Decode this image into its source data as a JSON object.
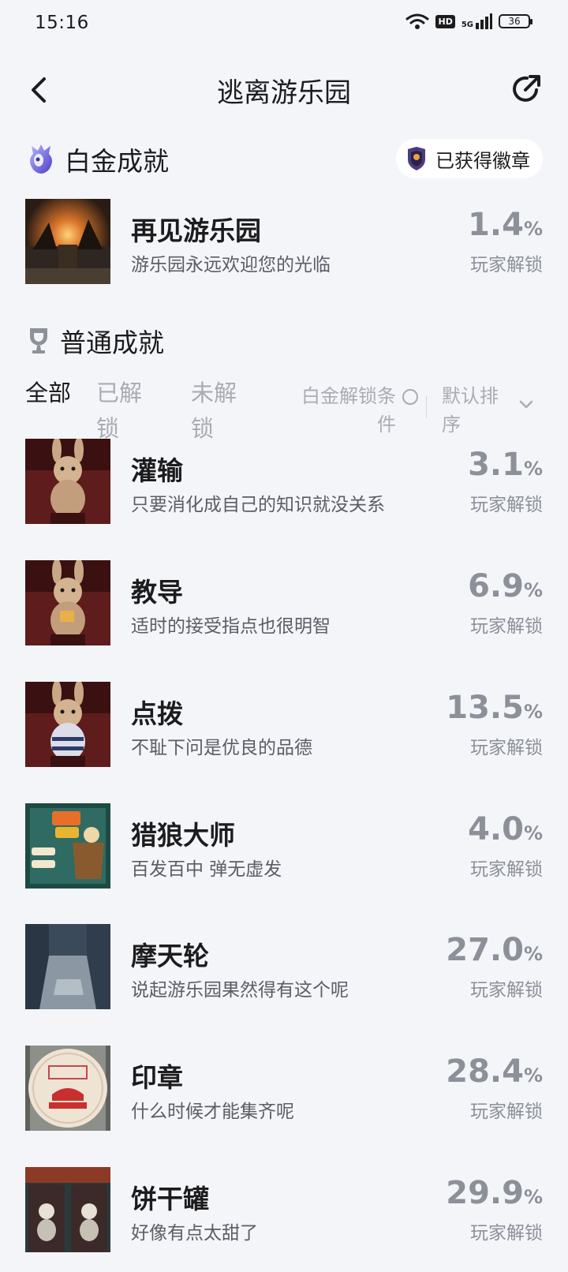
{
  "status_bar": {
    "time": "15:16",
    "hd": "HD",
    "network": "5G",
    "battery": "36"
  },
  "header": {
    "title": "逃离游乐园"
  },
  "platinum": {
    "section_title": "白金成就",
    "badge_label": "已获得徽章",
    "item": {
      "name": "再见游乐园",
      "desc": "游乐园永远欢迎您的光临",
      "percent": "1.4",
      "percent_sign": "%",
      "unlock_label": "玩家解锁"
    }
  },
  "normal": {
    "section_title": "普通成就",
    "filters": {
      "tabs": [
        "全部",
        "已解锁",
        "未解锁"
      ],
      "condition": "白金解锁条件",
      "sort": "默认排序"
    },
    "items": [
      {
        "name": "灌输",
        "desc": "只要消化成自己的知识就没关系",
        "percent": "3.1",
        "percent_sign": "%",
        "unlock_label": "玩家解锁"
      },
      {
        "name": "教导",
        "desc": "适时的接受指点也很明智",
        "percent": "6.9",
        "percent_sign": "%",
        "unlock_label": "玩家解锁"
      },
      {
        "name": "点拨",
        "desc": "不耻下问是优良的品德",
        "percent": "13.5",
        "percent_sign": "%",
        "unlock_label": "玩家解锁"
      },
      {
        "name": "猎狼大师",
        "desc": "百发百中 弹无虚发",
        "percent": "4.0",
        "percent_sign": "%",
        "unlock_label": "玩家解锁"
      },
      {
        "name": "摩天轮",
        "desc": "说起游乐园果然得有这个呢",
        "percent": "27.0",
        "percent_sign": "%",
        "unlock_label": "玩家解锁"
      },
      {
        "name": "印章",
        "desc": "什么时候才能集齐呢",
        "percent": "28.4",
        "percent_sign": "%",
        "unlock_label": "玩家解锁"
      },
      {
        "name": "饼干罐",
        "desc": "好像有点太甜了",
        "percent": "29.9",
        "percent_sign": "%",
        "unlock_label": "玩家解锁"
      }
    ]
  }
}
